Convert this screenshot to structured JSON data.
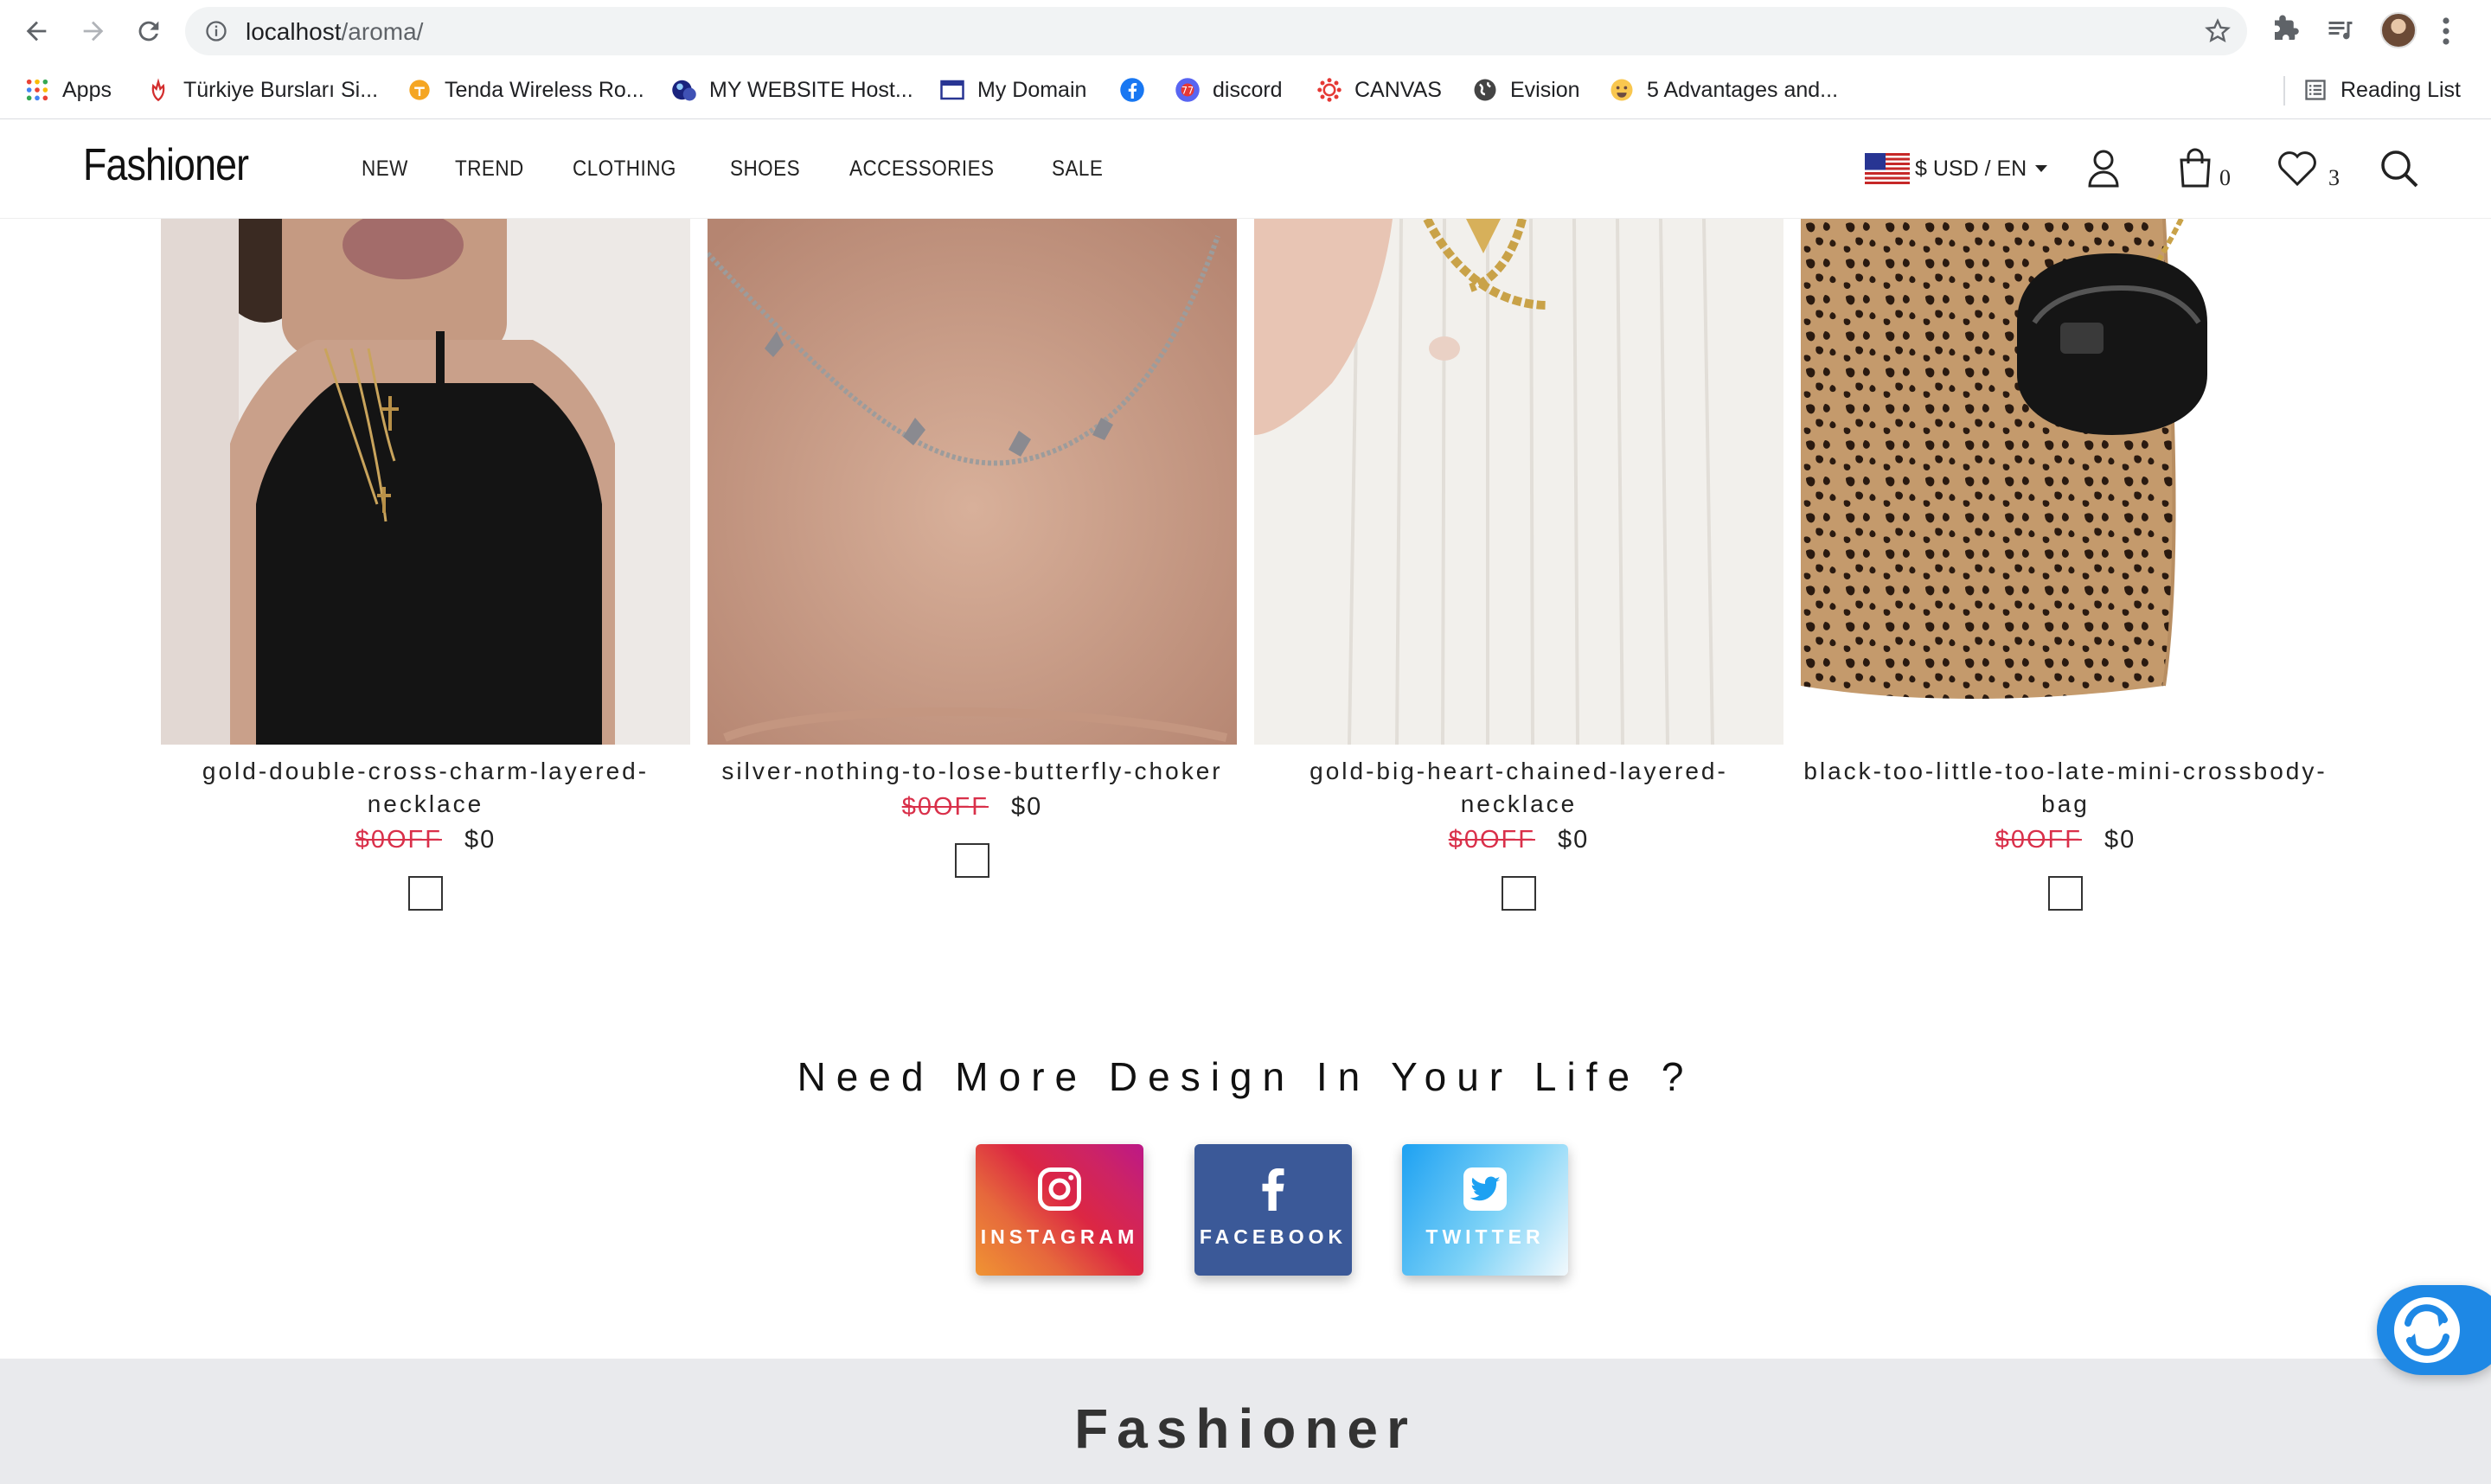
{
  "browser": {
    "url_host": "localhost",
    "url_path": "/aroma/",
    "bookmarks": [
      {
        "label": "Apps",
        "icon": "apps-grid-icon"
      },
      {
        "label": "Türkiye Bursları Si...",
        "icon": "tulip-icon"
      },
      {
        "label": "Tenda Wireless Ro...",
        "icon": "tenda-icon"
      },
      {
        "label": "MY WEBSITE Host...",
        "icon": "host-icon"
      },
      {
        "label": "My Domain",
        "icon": "domain-icon"
      },
      {
        "label": "",
        "icon": "facebook-icon"
      },
      {
        "label": "discord",
        "icon": "discord-icon"
      },
      {
        "label": "CANVAS",
        "icon": "canvas-icon"
      },
      {
        "label": "Evision",
        "icon": "globe-icon"
      },
      {
        "label": "5 Advantages and...",
        "icon": "emoji-icon"
      }
    ],
    "reading_list": "Reading List"
  },
  "header": {
    "logo": "Fashioner",
    "nav": [
      "NEW",
      "TREND",
      "CLOTHING",
      "SHOES",
      "ACCESSORIES",
      "SALE"
    ],
    "currency": "$ USD / EN",
    "cart_count": "0",
    "wishlist_count": "3"
  },
  "products": [
    {
      "name": "gold-double-cross-charm-layered-necklace",
      "old_price": "$0OFF",
      "price": "$0"
    },
    {
      "name": "silver-nothing-to-lose-butterfly-choker",
      "old_price": "$0OFF",
      "price": "$0"
    },
    {
      "name": "gold-big-heart-chained-layered-necklace",
      "old_price": "$0OFF",
      "price": "$0"
    },
    {
      "name": "black-too-little-too-late-mini-crossbody-bag",
      "old_price": "$0OFF",
      "price": "$0"
    }
  ],
  "cta": {
    "title": "Need More Design In Your Life ?",
    "social": [
      {
        "label": "INSTAGRAM",
        "icon": "instagram-icon"
      },
      {
        "label": "FACEBOOK",
        "icon": "facebook-icon"
      },
      {
        "label": "TWITTER",
        "icon": "twitter-icon"
      }
    ]
  },
  "footer": {
    "logo": "Fashioner"
  },
  "colors": {
    "sale_red": "#d9304a",
    "footer_bg": "#e9eaed",
    "chat_blue": "#1e88e5"
  }
}
